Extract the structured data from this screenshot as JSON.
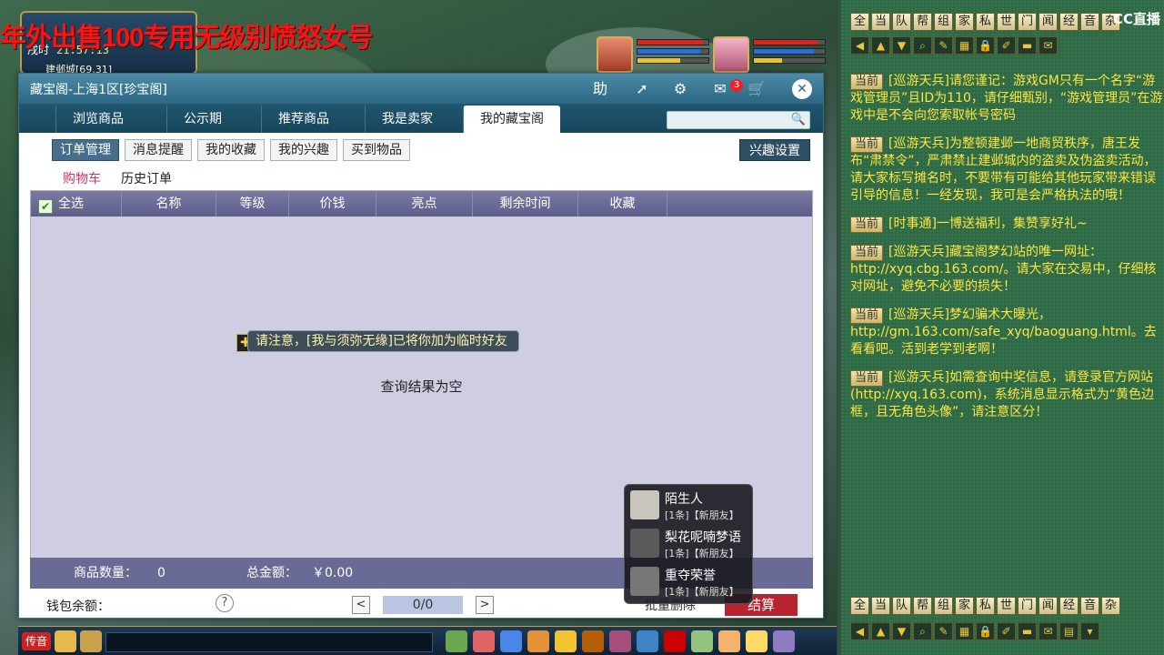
{
  "overlay": {
    "banner": "年外出售100专用无级别愤怒女号",
    "clock_label": "戌时",
    "clock_time": "21:57:13",
    "location": "建邺城[69,31]"
  },
  "window": {
    "title": "藏宝阁-上海1区[珍宝阁]",
    "help_icon": "助",
    "message_count": "3",
    "close_glyph": "✕"
  },
  "tabs": [
    {
      "label": "浏览商品"
    },
    {
      "label": "公示期"
    },
    {
      "label": "推荐商品"
    },
    {
      "label": "我是卖家"
    },
    {
      "label": "我的藏宝阁"
    }
  ],
  "search": {
    "placeholder": ""
  },
  "subtabs": [
    {
      "label": "订单管理"
    },
    {
      "label": "消息提醒"
    },
    {
      "label": "我的收藏"
    },
    {
      "label": "我的兴趣"
    },
    {
      "label": "买到物品"
    }
  ],
  "interest_button": "兴趣设置",
  "cart_tabs": {
    "cart": "购物车",
    "history": "历史订单"
  },
  "table": {
    "headers": [
      "全选",
      "名称",
      "等级",
      "价钱",
      "亮点",
      "剩余时间",
      "收藏"
    ],
    "empty": "查询结果为空"
  },
  "notice": "请注意，[我与须弥无缘]已将你加为临时好友",
  "summary": {
    "count_label": "商品数量：",
    "count_value": "0",
    "total_label": "总金额：",
    "total_value": "￥0.00"
  },
  "footer": {
    "wallet_label": "钱包余额：",
    "help_glyph": "?",
    "prev": "<",
    "next": ">",
    "page": "0/0",
    "batch": "批量删除",
    "checkout": "结算"
  },
  "friends": [
    {
      "name": "陌生人",
      "msg": "[1条]【新朋友】"
    },
    {
      "name": "梨花呢喃梦语",
      "msg": "[1条]【新朋友】"
    },
    {
      "name": "重夺荣誉",
      "msg": "[1条]【新朋友】"
    }
  ],
  "chat": {
    "channels": [
      "全",
      "当",
      "队",
      "帮",
      "组",
      "家",
      "私",
      "世",
      "门",
      "闻",
      "经",
      "音",
      "杂"
    ],
    "logo": "CC直播",
    "messages": [
      {
        "tag": "当前",
        "speaker": "[巡游天兵]",
        "text": "请您谨记：游戏GM只有一个名字“游戏管理员”且ID为110，请仔细甄别，“游戏管理员”在游戏中是不会向您索取帐号密码"
      },
      {
        "tag": "当前",
        "speaker": "[巡游天兵]",
        "text": "为整顿建邺一地商贸秩序，唐王发布“肃禁令”，严肃禁止建邺城内的盗卖及伪盗卖活动，请大家标写摊名时，不要带有可能给其他玩家带来错误引导的信息！一经发现，我可是会严格执法的哦！"
      },
      {
        "tag": "当前",
        "speaker": "[时事通]",
        "text": "一博送福利，集赞享好礼~"
      },
      {
        "tag": "当前",
        "speaker": "[巡游天兵]",
        "text": "藏宝阁梦幻站的唯一网址：http://xyq.cbg.163.com/。请大家在交易中，仔细核对网址，避免不必要的损失！"
      },
      {
        "tag": "当前",
        "speaker": "[巡游天兵]",
        "text": "梦幻骗术大曝光，http://gm.163.com/safe_xyq/baoguang.html。去看看吧。活到老学到老啊！"
      },
      {
        "tag": "当前",
        "speaker": "[巡游天兵]",
        "text": "如需查询中奖信息，请登录官方网站(http://xyq.163.com)，系统消息显示格式为“黄色边框，且无角色头像”，请注意区分！"
      }
    ]
  },
  "bottom": {
    "voice": "传音"
  },
  "colors": {
    "accent": "#2c6784",
    "checkout": "#b82330",
    "chat_text": "#ffe640"
  }
}
